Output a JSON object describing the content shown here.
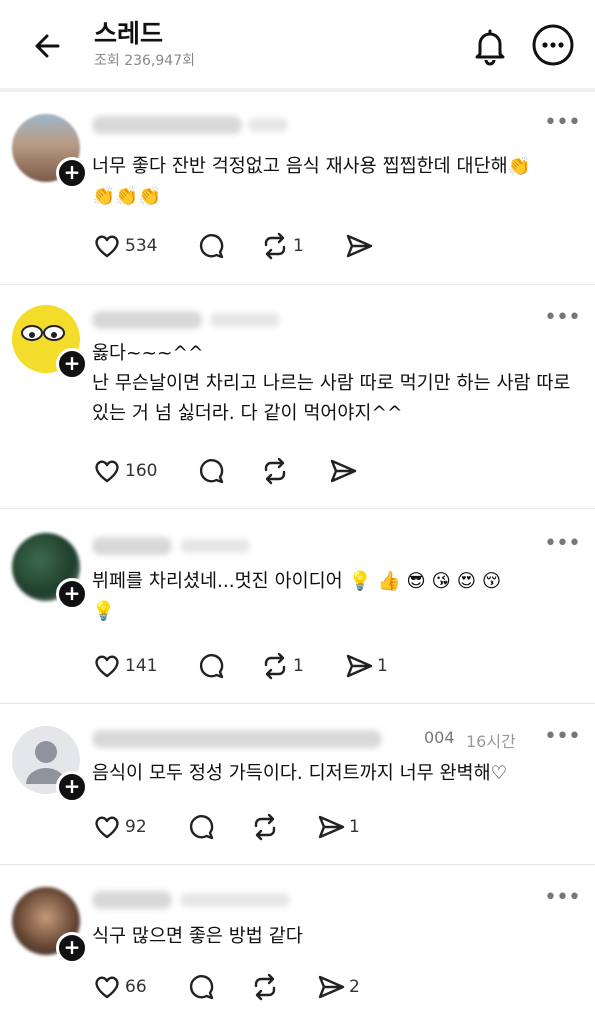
{
  "header": {
    "title": "스레드",
    "views": "조회 236,947회"
  },
  "posts": [
    {
      "text": "너무 좋다 잔반 걱정없고 음식 재사용 찝찝한데 대단해👏\n👏👏👏",
      "likes": "534",
      "reposts": "1",
      "shares": ""
    },
    {
      "text": "옳다~~~^^\n난 무슨날이면 차리고 나르는 사람 따로 먹기만 하는 사람 따로 있는 거 넘 싫더라. 다 같이 먹어야지^^",
      "likes": "160",
      "reposts": "",
      "shares": ""
    },
    {
      "text": "뷔페를 차리셨네...멋진 아이디어 💡 👍 😎 😘 😍 😚\n💡",
      "likes": "141",
      "reposts": "1",
      "shares": "1"
    },
    {
      "text": "음식이 모두 정성 가득이다. 디저트까지 너무 완벽해♡",
      "likes": "92",
      "reposts": "",
      "shares": "1",
      "name_tail": "004",
      "time": "16시간"
    },
    {
      "text": "식구 많으면 좋은 방법 같다",
      "likes": "66",
      "reposts": "",
      "shares": "2"
    }
  ],
  "icons": {
    "back": "arrow-left-icon",
    "bell": "bell-icon",
    "more": "more-horizontal-icon",
    "like": "heart-icon",
    "comment": "comment-icon",
    "repost": "repost-icon",
    "share": "send-icon"
  },
  "colors": {
    "text": "#111111",
    "muted": "#8a8a8a",
    "divider": "#e8e8e8"
  }
}
